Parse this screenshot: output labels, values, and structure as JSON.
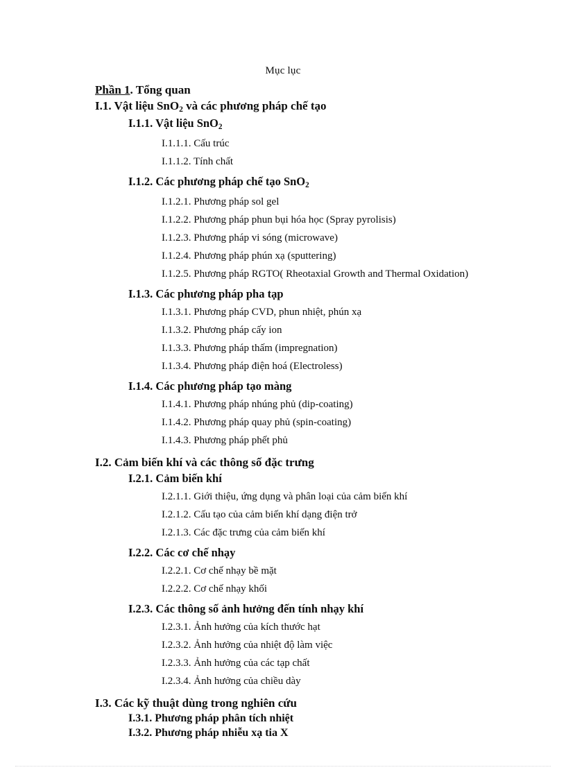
{
  "document": {
    "title": "Mục lục"
  },
  "toc": {
    "entries": [
      {
        "level": 1,
        "text": "Phần 1",
        "text_rest": ". Tổng quan",
        "underlined_prefix": true
      },
      {
        "level": 1,
        "text_before_sub": "I.1. Vật liệu SnO",
        "sub": "2",
        "text_after_sub": " và các phương pháp chế tạo"
      },
      {
        "level": 2,
        "text_before_sub": "I.1.1. Vật liệu SnO",
        "sub": "2",
        "text_after_sub": ""
      },
      {
        "level": 3,
        "text": "I.1.1.1. Cấu trúc"
      },
      {
        "level": 3,
        "text": "I.1.1.2. Tính chất"
      },
      {
        "level": 2,
        "text_before_sub": "I.1.2. Các phương pháp chế tạo SnO",
        "sub": "2",
        "text_after_sub": ""
      },
      {
        "level": 3,
        "text": "I.1.2.1. Phương pháp sol gel"
      },
      {
        "level": 3,
        "text": "I.1.2.2. Phương pháp phun bụi hóa học (Spray pyrolisis)"
      },
      {
        "level": 3,
        "text": "I.1.2.3. Phương pháp vi sóng (microwave)"
      },
      {
        "level": 3,
        "text": "I.1.2.4. Phương pháp phún xạ (sputtering)"
      },
      {
        "level": 3,
        "text": "I.1.2.5. Phương pháp RGTO( Rheotaxial Growth and Thermal Oxidation)",
        "justified": true
      },
      {
        "level": 2,
        "text": "I.1.3. Các phương pháp pha tạp"
      },
      {
        "level": 3,
        "text": "I.1.3.1. Phương pháp CVD, phun nhiệt, phún xạ"
      },
      {
        "level": 3,
        "text": "I.1.3.2. Phương pháp cấy ion"
      },
      {
        "level": 3,
        "text": "I.1.3.3. Phương pháp thấm (impregnation)"
      },
      {
        "level": 3,
        "text": "I.1.3.4. Phương pháp điện hoá (Electroless)"
      },
      {
        "level": 2,
        "text": "I.1.4. Các phương pháp tạo màng"
      },
      {
        "level": 3,
        "text": "I.1.4.1. Phương pháp nhúng phủ (dip-coating)"
      },
      {
        "level": 3,
        "text": "I.1.4.2. Phương pháp quay phủ (spin-coating)"
      },
      {
        "level": 3,
        "text": "I.1.4.3. Phương pháp phết phủ"
      },
      {
        "level": 1,
        "text": "I.2. Cảm biến khí và các thông số đặc trưng"
      },
      {
        "level": 2,
        "text": "I.2.1. Cảm biến khí"
      },
      {
        "level": 3,
        "text": "I.2.1.1. Giới thiệu, ứng dụng và phân loại của cảm biến khí"
      },
      {
        "level": 3,
        "text": "I.2.1.2. Cấu tạo của cảm biến khí dạng điện trở"
      },
      {
        "level": 3,
        "text": "I.2.1.3. Các đặc trưng của cảm biến khí"
      },
      {
        "level": 2,
        "text": "I.2.2. Các cơ chế nhạy"
      },
      {
        "level": 3,
        "text": "I.2.2.1. Cơ chế nhạy bề mặt"
      },
      {
        "level": 3,
        "text": "I.2.2.2. Cơ chế nhạy khối"
      },
      {
        "level": 2,
        "text": "I.2.3. Các thông số ảnh hưởng đến tính nhạy khí"
      },
      {
        "level": 3,
        "text": "I.2.3.1. Ảnh hưởng của kích thước hạt"
      },
      {
        "level": 3,
        "text": "I.2.3.2. Ảnh hưởng của nhiệt độ làm việc"
      },
      {
        "level": 3,
        "text": "I.2.3.3. Ảnh hưởng của các tạp chất"
      },
      {
        "level": 3,
        "text": "I.2.3.4. Ảnh hưởng của chiều dày"
      },
      {
        "level": 1,
        "text": "I.3. Các kỹ thuật dùng trong nghiên cứu"
      },
      {
        "level": 2,
        "text": "I.3.1. Phương pháp phân tích nhiệt",
        "tight": true
      },
      {
        "level": 2,
        "text": "I.3.2. Phương pháp nhiễu xạ tia X",
        "tight": true
      }
    ]
  }
}
